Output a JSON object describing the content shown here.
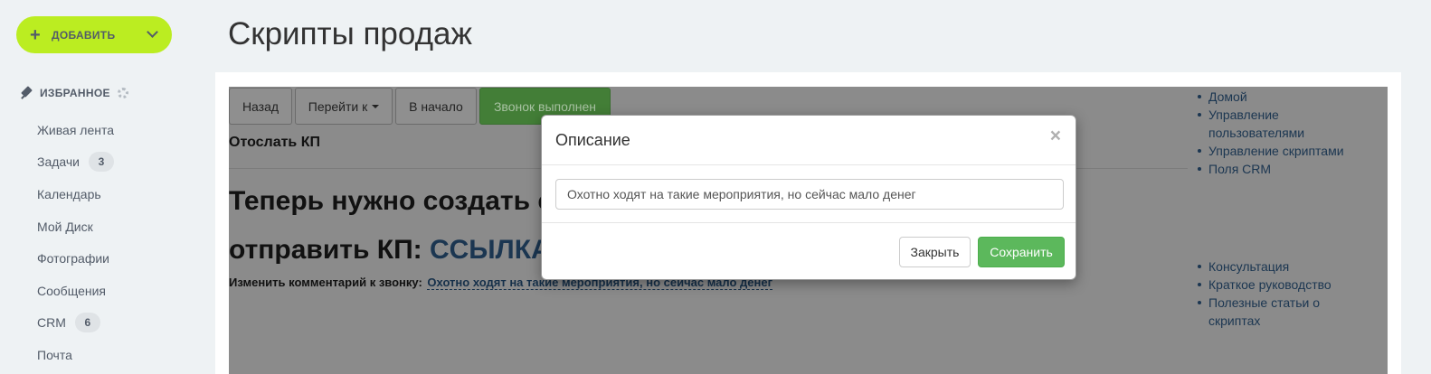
{
  "sidebar": {
    "add_button": {
      "label": "ДОБАВИТЬ"
    },
    "favorites": {
      "title": "ИЗБРАННОЕ"
    },
    "items": [
      {
        "label": "Живая лента",
        "count": null
      },
      {
        "label": "Задачи",
        "count": "3"
      },
      {
        "label": "Календарь",
        "count": null
      },
      {
        "label": "Мой Диск",
        "count": null
      },
      {
        "label": "Фотографии",
        "count": null
      },
      {
        "label": "Сообщения",
        "count": null
      },
      {
        "label": "CRM",
        "count": "6"
      },
      {
        "label": "Почта",
        "count": null
      }
    ]
  },
  "page": {
    "title": "Скрипты продаж"
  },
  "toolbar": {
    "back": "Назад",
    "goto": "Перейти к",
    "start": "В начало",
    "done": "Звонок выполнен"
  },
  "script": {
    "step_title": "Отослать КП",
    "line1": "Теперь нужно создать с",
    "line2_prefix": "отправить КП: ",
    "line2_link": "ССЫЛКА",
    "comment_label": "Изменить комментарий к звонку:",
    "comment_value": "Охотно ходят на такие мероприятия, но сейчас мало денег"
  },
  "right_links": {
    "top": [
      "Домой",
      "Управление пользователями",
      "Управление скриптами",
      "Поля CRM"
    ],
    "bottom": [
      "Консультация",
      "Краткое руководство",
      "Полезные статьи о скриптах"
    ]
  },
  "modal": {
    "title": "Описание",
    "close_glyph": "×",
    "input_value": "Охотно ходят на такие мероприятия, но сейчас мало денег",
    "close_button": "Закрыть",
    "save_button": "Сохранить"
  },
  "colors": {
    "add_button": "#bbed21",
    "save_button": "#5cb85c",
    "done_button": "#437e37",
    "link": "#1b3651"
  }
}
